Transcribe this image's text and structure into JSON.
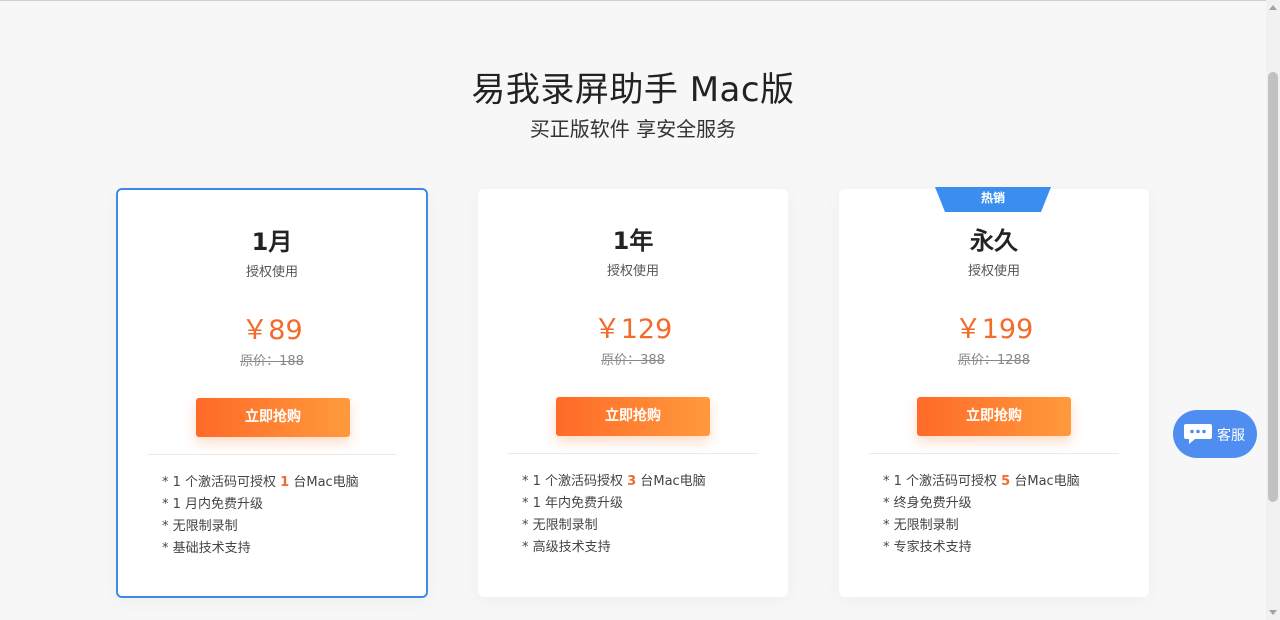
{
  "header": {
    "title": "易我录屏助手 Mac版",
    "subtitle": "买正版软件 享安全服务"
  },
  "plans": [
    {
      "name": "1月",
      "usage": "授权使用",
      "price": "￥89",
      "original_price": "原价：188",
      "buy_label": "立即抢购",
      "features": [
        {
          "prefix": "* 1 个激活码可授权 ",
          "highlight": "1",
          "suffix": " 台Mac电脑"
        },
        {
          "prefix": "* 1 月内免费升级",
          "highlight": "",
          "suffix": ""
        },
        {
          "prefix": "* 无限制录制",
          "highlight": "",
          "suffix": ""
        },
        {
          "prefix": "* 基础技术支持",
          "highlight": "",
          "suffix": ""
        }
      ]
    },
    {
      "name": "1年",
      "usage": "授权使用",
      "price": "￥129",
      "original_price": "原价：388",
      "buy_label": "立即抢购",
      "features": [
        {
          "prefix": "* 1 个激活码授权 ",
          "highlight": "3",
          "suffix": " 台Mac电脑"
        },
        {
          "prefix": "* 1 年内免费升级",
          "highlight": "",
          "suffix": ""
        },
        {
          "prefix": "* 无限制录制",
          "highlight": "",
          "suffix": ""
        },
        {
          "prefix": "* 高级技术支持",
          "highlight": "",
          "suffix": ""
        }
      ]
    },
    {
      "badge": "热销",
      "name": "永久",
      "usage": "授权使用",
      "price": "￥199",
      "original_price": "原价：1288",
      "buy_label": "立即抢购",
      "features": [
        {
          "prefix": "* 1 个激活码可授权 ",
          "highlight": "5",
          "suffix": " 台Mac电脑"
        },
        {
          "prefix": "* 终身免费升级",
          "highlight": "",
          "suffix": ""
        },
        {
          "prefix": "* 无限制录制",
          "highlight": "",
          "suffix": ""
        },
        {
          "prefix": "* 专家技术支持",
          "highlight": "",
          "suffix": ""
        }
      ]
    }
  ],
  "customer_service": {
    "label": "客服",
    "icon": "chat-bubble-icon"
  },
  "colors": {
    "accent_orange": "#f26b2a",
    "selected_border": "#3d8be6",
    "badge_blue": "#3a8ef0",
    "service_blue": "#4f8ef0"
  }
}
